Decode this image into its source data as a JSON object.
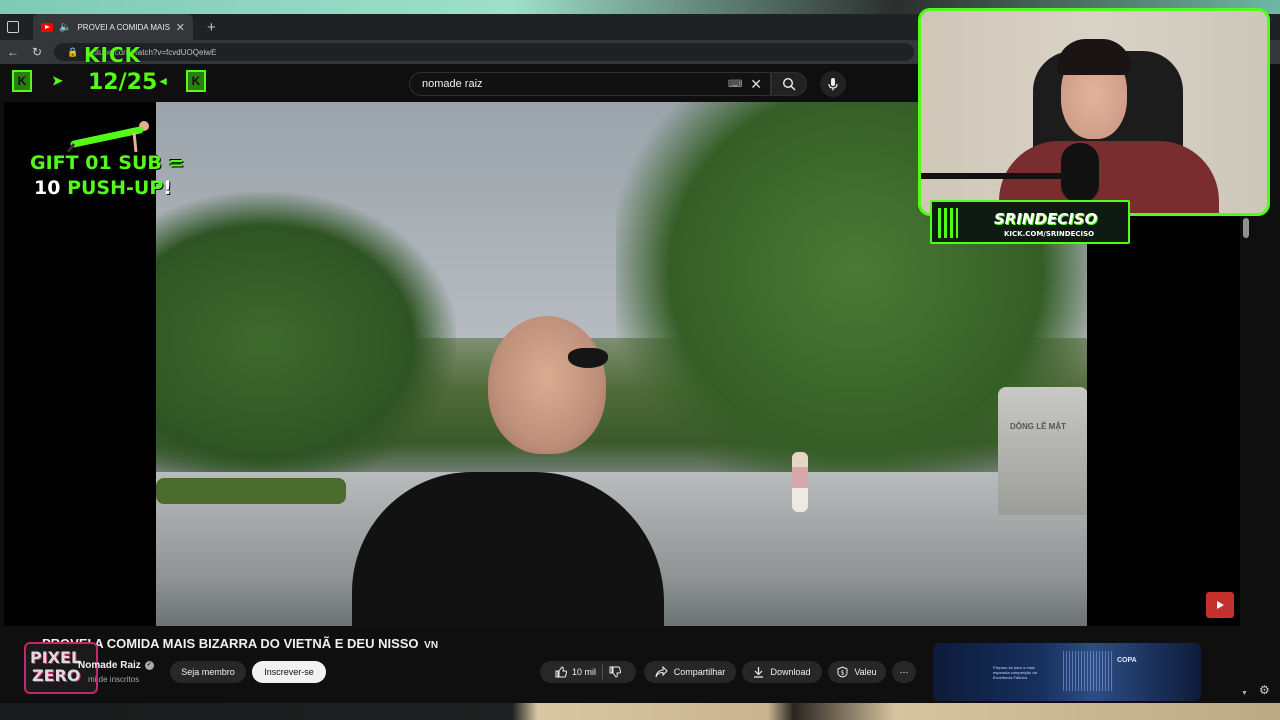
{
  "browser": {
    "tab_title": "PROVEI A COMIDA MAIS BI",
    "url": "outube.com/watch?v=fcvdUOQeiwE"
  },
  "search": {
    "query": "nomade raiz"
  },
  "overlay": {
    "kick_logo": "KICK",
    "goal_count": "12/25",
    "gift_line1": "GIFT 01 SUB =",
    "gift_line2_pre": "10 ",
    "gift_line2_accent": "PUSH-UP",
    "gift_line2_post": "!",
    "streamer_name": "SRINDECISO",
    "streamer_url": "KICK.COM/SRINDECISO"
  },
  "scene": {
    "stone_text": "DÔNG LẼ MẶT"
  },
  "video": {
    "title": "PROVEI A COMIDA MAIS BIZARRA DO VIETNÃ E DEU NISSO",
    "title_suffix": "VN"
  },
  "channel": {
    "logo_line1": "PIXEL",
    "logo_line2": "ZERO",
    "name": "Nomade Raiz",
    "subscribers": "mi de inscritos",
    "member_label": "Seja membro",
    "subscribe_label": "Inscrever-se"
  },
  "actions": {
    "likes": "10 mil",
    "share_label": "Compartilhar",
    "download_label": "Download",
    "thanks_label": "Valeu"
  },
  "ad": {
    "brand": "COPA",
    "text": "Preparo-se para a mais esperada competição da Excelência Fábrica"
  }
}
